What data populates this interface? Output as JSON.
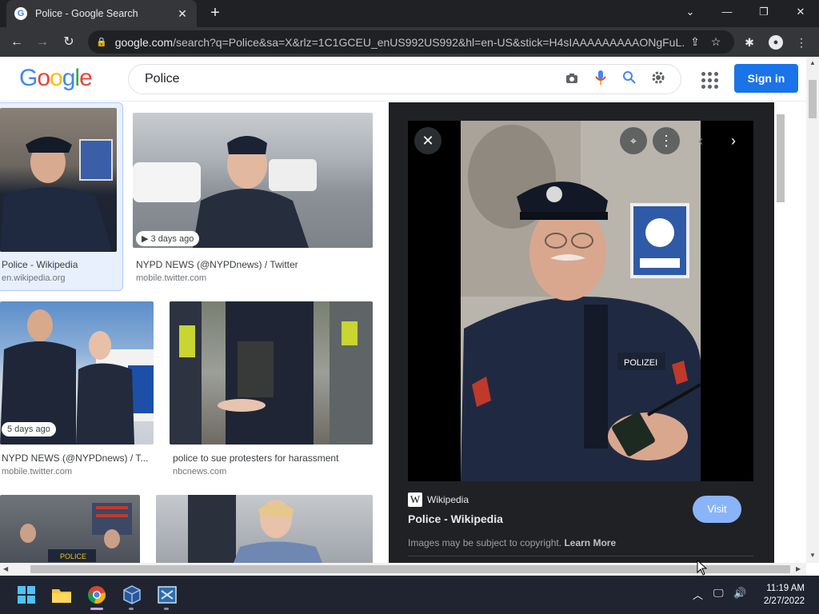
{
  "browser": {
    "tab_title": "Police - Google Search",
    "tab_favicon": "G",
    "new_tab": "+",
    "url_host": "google.com",
    "url_path": "/search?q=Police&sa=X&rlz=1C1GCEU_enUS992US992&hl=en-US&stick=H4sIAAAAAAAAAONgFuL...",
    "controls": {
      "tab_search": "⌄",
      "minimize": "—",
      "restore": "❐",
      "close": "✕"
    }
  },
  "google": {
    "logo": [
      "G",
      "o",
      "o",
      "g",
      "l",
      "e"
    ],
    "query": "Police",
    "sign_in": "Sign in"
  },
  "results": [
    {
      "title": "Police - Wikipedia",
      "source": "en.wikipedia.org",
      "badge": ""
    },
    {
      "title": "NYPD NEWS (@NYPDnews) / Twitter",
      "source": "mobile.twitter.com",
      "badge": "3 days ago"
    },
    {
      "title": "NYPD NEWS (@NYPDnews) / T...",
      "source": "mobile.twitter.com",
      "badge": "5 days ago"
    },
    {
      "title": "police to sue protesters for harassment",
      "source": "nbcnews.com",
      "badge": ""
    }
  ],
  "preview": {
    "source": "Wikipedia",
    "source_logo": "W",
    "title": "Police - Wikipedia",
    "visit": "Visit",
    "copyright": "Images may be subject to copyright.",
    "learn_more": "Learn More"
  },
  "taskbar": {
    "time": "11:19 AM",
    "date": "2/27/2022"
  },
  "colors": {
    "accent": "#1a73e8",
    "visit": "#8ab4f8",
    "panel": "#202124"
  }
}
